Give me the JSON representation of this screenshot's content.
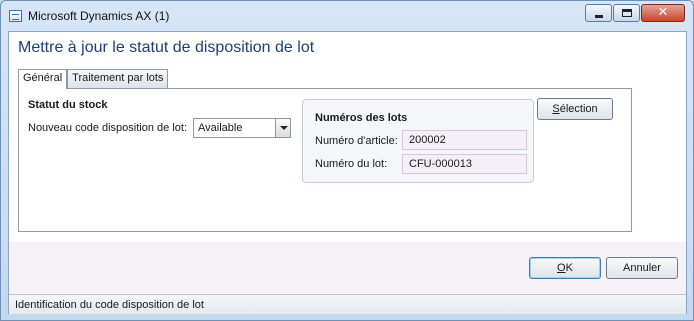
{
  "window": {
    "title": "Microsoft Dynamics AX (1)",
    "controls": {
      "minimize": "minimize",
      "maximize": "maximize",
      "close": "✕"
    }
  },
  "form": {
    "title": "Mettre à jour le statut de disposition de lot"
  },
  "tabs": [
    {
      "label": "Général",
      "active": true
    },
    {
      "label": "Traitement par lots",
      "active": false
    }
  ],
  "stock_status": {
    "group_title": "Statut du stock",
    "new_code_label": "Nouveau code disposition de lot:",
    "new_code_value": "Available"
  },
  "lot_numbers": {
    "group_title": "Numéros des lots",
    "item_number_label": "Numéro d'article:",
    "item_number_value": "200002",
    "lot_number_label": "Numéro du lot:",
    "lot_number_value": "CFU-000013"
  },
  "buttons": {
    "selection": {
      "prefix": "",
      "accel": "S",
      "rest": "élection"
    },
    "ok": {
      "accel": "O",
      "rest": "K"
    },
    "cancel": "Annuler"
  },
  "status_bar": {
    "text": "Identification du code disposition de lot"
  },
  "colors": {
    "title_blue": "#1e3f74",
    "readonly_field_bg": "#f7eff7",
    "footer_band": "#f6f1f6"
  }
}
